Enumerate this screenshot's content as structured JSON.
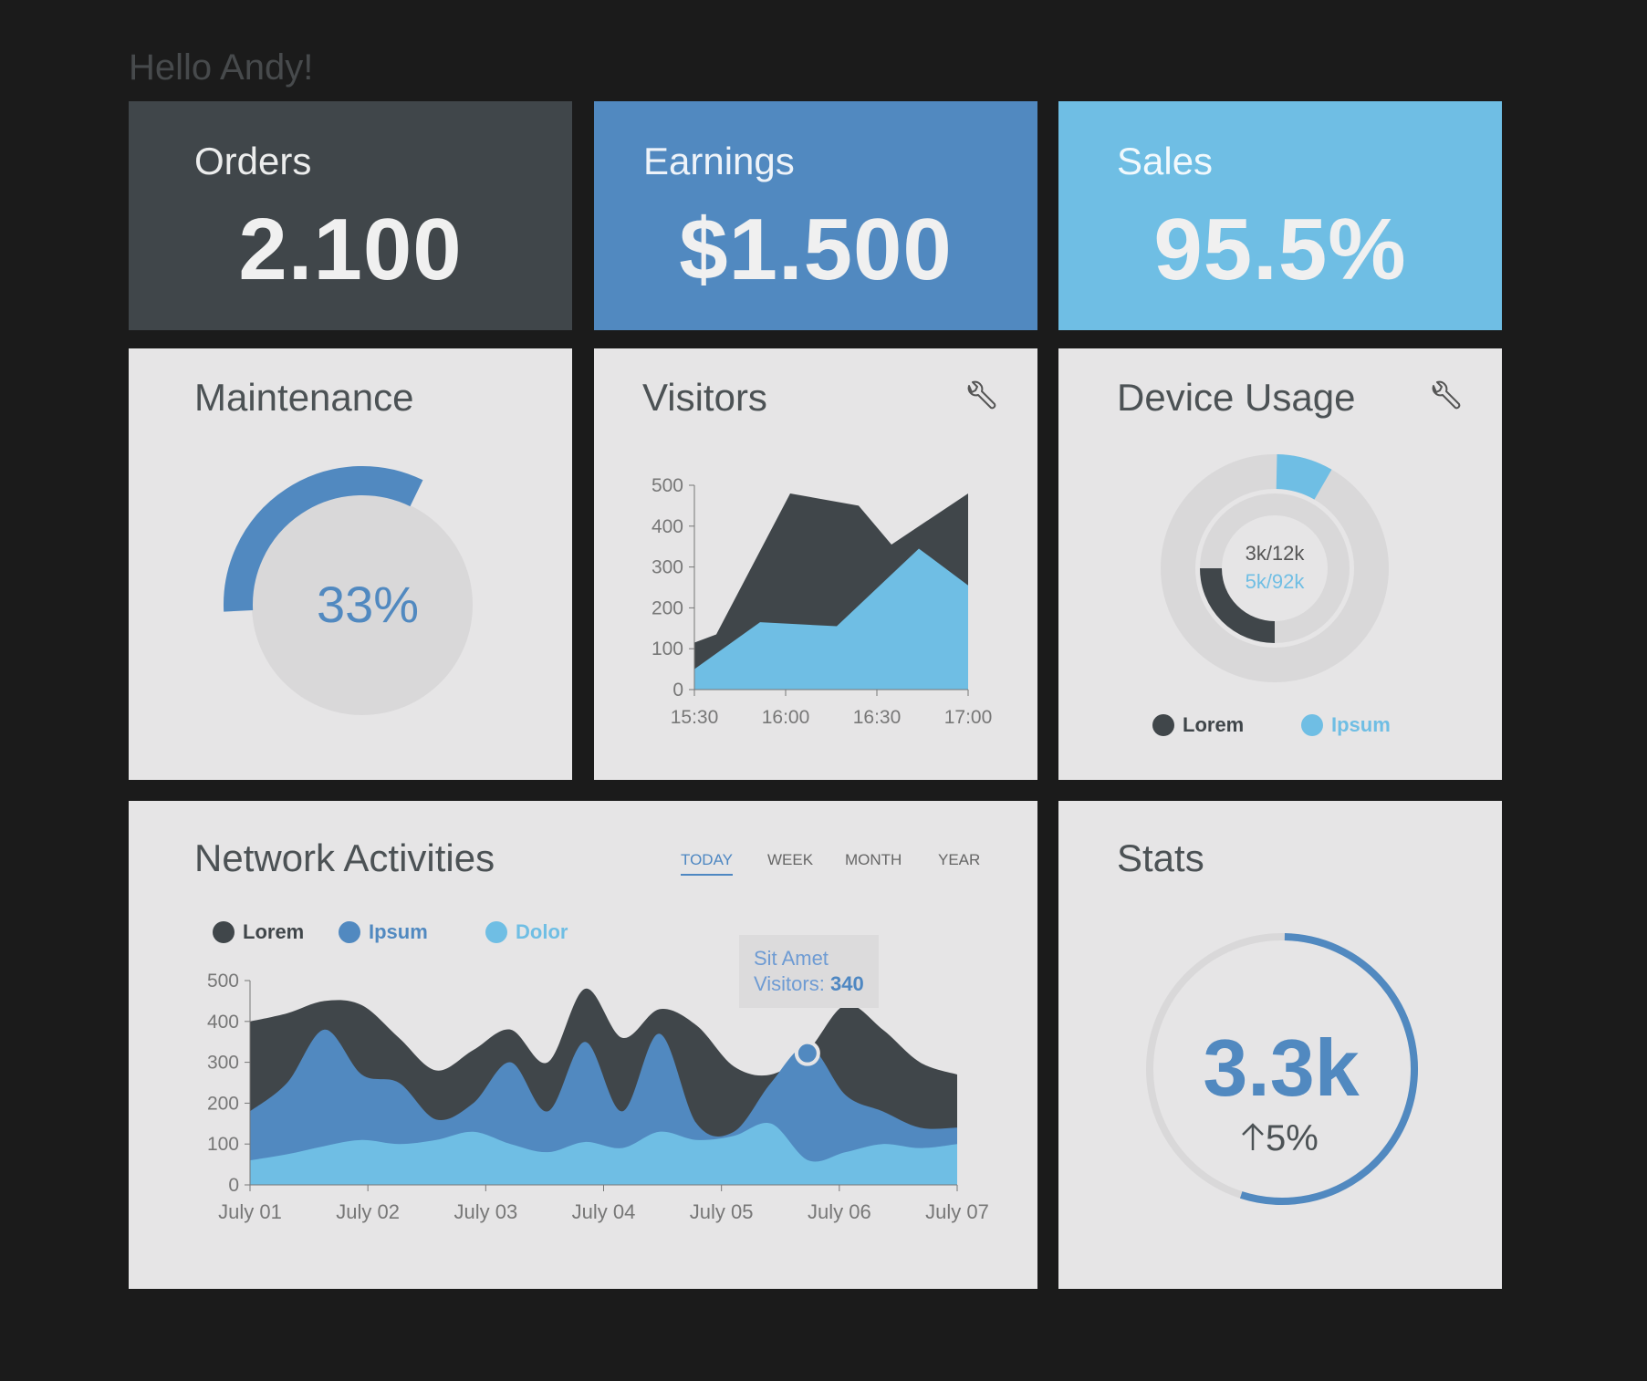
{
  "greeting": "Hello Andy!",
  "kpis": {
    "orders": {
      "label": "Orders",
      "value": "2.100",
      "color": "#40464a"
    },
    "earnings": {
      "label": "Earnings",
      "value": "$1.500",
      "color": "#5189c0"
    },
    "sales": {
      "label": "Sales",
      "value": "95.5%",
      "color": "#6fbee4"
    }
  },
  "maintenance": {
    "title": "Maintenance",
    "percent_text": "33%",
    "progress": 0.33
  },
  "visitors": {
    "title": "Visitors",
    "settings_icon": "wrench-icon",
    "chart_data": {
      "type": "area",
      "x": [
        "15:30",
        "15:45",
        "16:00",
        "16:15",
        "16:30",
        "16:45",
        "17:00"
      ],
      "x_ticks": [
        "15:30",
        "16:00",
        "16:30",
        "17:00"
      ],
      "ylim": [
        0,
        500
      ],
      "y_ticks": [
        "0",
        "100",
        "200",
        "300",
        "400",
        "500"
      ],
      "series": [
        {
          "values": [
            115,
            135,
            480,
            450,
            355,
            480
          ],
          "x": [
            0,
            0.08,
            0.35,
            0.6,
            0.72,
            1.0
          ],
          "color": "#40464a"
        },
        {
          "values": [
            50,
            165,
            155,
            345,
            255
          ],
          "x": [
            0,
            0.24,
            0.52,
            0.82,
            1.0
          ],
          "color": "#6fbee4"
        }
      ]
    }
  },
  "device_usage": {
    "title": "Device Usage",
    "settings_icon": "wrench-icon",
    "center_line1": "3k/12k",
    "center_line2": "5k/92k",
    "chart_data": {
      "type": "pie",
      "rings": [
        {
          "name": "Lorem",
          "fraction": 0.25,
          "color": "#40464a"
        },
        {
          "name": "Ipsum",
          "fraction": 0.0833,
          "color": "#6fbee4"
        }
      ]
    },
    "legend": [
      {
        "name": "Lorem",
        "color": "#40464a"
      },
      {
        "name": "Ipsum",
        "color": "#6fbee4"
      }
    ]
  },
  "network": {
    "title": "Network Activities",
    "tabs": [
      "TODAY",
      "WEEK",
      "MONTH",
      "YEAR"
    ],
    "active_tab": "TODAY",
    "legend": [
      {
        "name": "Lorem",
        "color": "#40464a"
      },
      {
        "name": "Ipsum",
        "color": "#5189c0"
      },
      {
        "name": "Dolor",
        "color": "#6fbee4"
      }
    ],
    "tooltip": {
      "title": "Sit Amet",
      "label": "Visitors:",
      "value": "340"
    },
    "chart_data": {
      "type": "area",
      "x_ticks": [
        "July 01",
        "July 02",
        "July 03",
        "July 04",
        "July 05",
        "July 06",
        "July 07"
      ],
      "ylim": [
        0,
        500
      ],
      "y_ticks": [
        "0",
        "100",
        "200",
        "300",
        "400",
        "500"
      ],
      "series": [
        {
          "name": "Lorem",
          "color": "#40464a",
          "values": [
            400,
            420,
            450,
            440,
            360,
            280,
            330,
            380,
            300,
            480,
            360,
            430,
            390,
            290,
            270,
            330,
            440,
            380,
            300,
            270
          ]
        },
        {
          "name": "Ipsum",
          "color": "#5189c0",
          "values": [
            180,
            250,
            380,
            270,
            250,
            160,
            200,
            300,
            180,
            350,
            180,
            370,
            150,
            130,
            250,
            340,
            220,
            180,
            140,
            140
          ]
        },
        {
          "name": "Dolor",
          "color": "#6fbee4",
          "values": [
            60,
            75,
            95,
            110,
            100,
            110,
            130,
            100,
            80,
            105,
            90,
            130,
            110,
            120,
            150,
            60,
            80,
            100,
            90,
            100
          ]
        }
      ]
    }
  },
  "stats": {
    "title": "Stats",
    "value": "3.3k",
    "change": "5%",
    "change_icon": "arrow-up-icon",
    "progress": 0.55,
    "color": "#5189c0"
  }
}
